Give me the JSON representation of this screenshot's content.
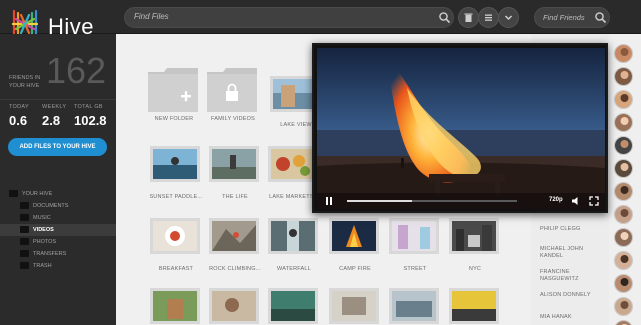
{
  "app": {
    "title": "Hive"
  },
  "search": {
    "placeholder": "Find Files"
  },
  "friends_search": {
    "placeholder": "Find Friends"
  },
  "sidebar": {
    "friends_caption": "FRIENDS IN YOUR HIVE",
    "friends_count": "162",
    "stats": [
      {
        "label": "TODAY",
        "value": "0.6"
      },
      {
        "label": "WEEKLY",
        "value": "2.8"
      },
      {
        "label": "TOTAL GB",
        "value": "102.8"
      }
    ],
    "add_button": "ADD FILES TO YOUR HIVE",
    "tree": [
      {
        "label": "YOUR HIVE",
        "level": 0,
        "active": false
      },
      {
        "label": "DOCUMENTS",
        "level": 1,
        "active": false
      },
      {
        "label": "MUSIC",
        "level": 1,
        "active": false
      },
      {
        "label": "VIDEOS",
        "level": 1,
        "active": true
      },
      {
        "label": "PHOTOS",
        "level": 1,
        "active": false
      },
      {
        "label": "TRANSFERS",
        "level": 1,
        "active": false
      },
      {
        "label": "TRASH",
        "level": 1,
        "active": false
      }
    ]
  },
  "files": [
    {
      "label": "NEW FOLDER",
      "kind": "new-folder"
    },
    {
      "label": "FAMILY VIDEOS",
      "kind": "locked-folder"
    },
    {
      "label": "LAKE VIEW",
      "kind": "video"
    },
    {
      "label": "SUNSET PADDLE...",
      "kind": "video"
    },
    {
      "label": "THE LIFE",
      "kind": "video"
    },
    {
      "label": "LAKE MARKETS...",
      "kind": "video"
    },
    {
      "label": "BREAKFAST",
      "kind": "video"
    },
    {
      "label": "ROCK CLIMBING...",
      "kind": "video"
    },
    {
      "label": "WATERFALL",
      "kind": "video"
    },
    {
      "label": "CAMP FIRE",
      "kind": "video"
    },
    {
      "label": "STREET",
      "kind": "video"
    },
    {
      "label": "NYC",
      "kind": "video"
    },
    {
      "label": "",
      "kind": "video"
    },
    {
      "label": "",
      "kind": "video"
    },
    {
      "label": "",
      "kind": "video"
    },
    {
      "label": "",
      "kind": "video"
    },
    {
      "label": "",
      "kind": "video"
    },
    {
      "label": "",
      "kind": "video"
    }
  ],
  "player": {
    "quality": "720p",
    "progress": 0.38
  },
  "friends": [
    "PHILIP CLEGG",
    "MICHAEL JOHN KANDEL",
    "FRANCINE NASGUEWITZ",
    "ALISON DONNELY",
    "MIA HANAK"
  ],
  "colors": {
    "accent": "#1f8fd1",
    "sidebar": "#2b2b2b",
    "topbar": "#2a2a2a"
  },
  "icons": [
    "hive-logo-icon",
    "search-icon",
    "trash-icon",
    "menu-icon",
    "chevron-down-icon",
    "search-icon",
    "play-icon",
    "volume-icon",
    "fullscreen-icon",
    "folder-icon",
    "lock-icon",
    "plus-icon"
  ]
}
